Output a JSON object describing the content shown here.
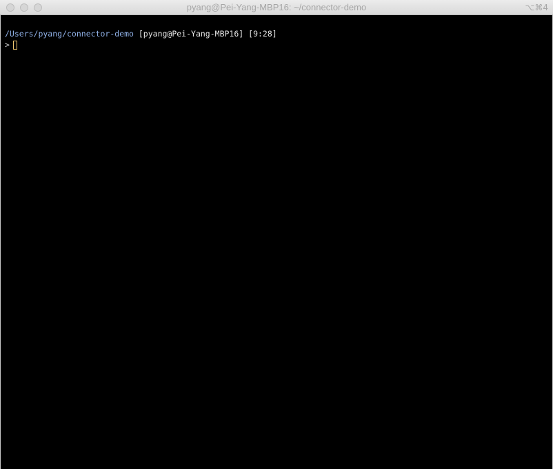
{
  "window": {
    "title": "pyang@Pei-Yang-MBP16: ~/connector-demo",
    "shortcut": "⌥⌘4"
  },
  "terminal": {
    "line1": {
      "path": "/Users/pyang/connector-demo",
      "host": "[pyang@Pei-Yang-MBP16]",
      "time": "[9:28]"
    },
    "line2": {
      "prompt": ">"
    }
  },
  "colors": {
    "background": "#000000",
    "path": "#8fb0e6",
    "text": "#e6e6e6",
    "cursor": "#f0c770"
  }
}
